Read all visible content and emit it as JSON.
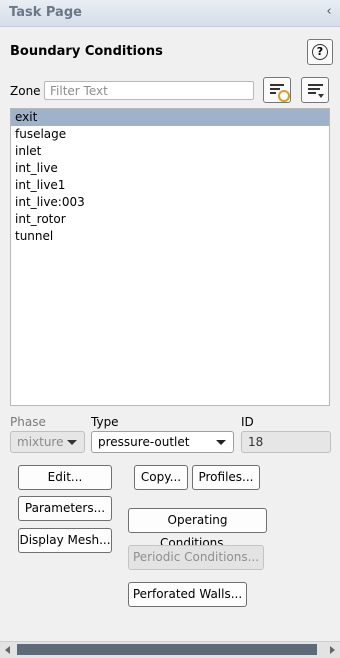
{
  "panel": {
    "title": "Task Page",
    "collapse_glyph": "‹"
  },
  "heading": "Boundary Conditions",
  "help_glyph": "?",
  "zone": {
    "label": "Zone",
    "filter_placeholder": "Filter Text",
    "filter_value": "",
    "items": [
      "exit",
      "fuselage",
      "inlet",
      "int_live",
      "int_live1",
      "int_live:003",
      "int_rotor",
      "tunnel"
    ],
    "selected_index": 0
  },
  "fields": {
    "phase_label": "Phase",
    "phase_value": "mixture",
    "type_label": "Type",
    "type_value": "pressure-outlet",
    "id_label": "ID",
    "id_value": "18"
  },
  "buttons": {
    "edit": "Edit...",
    "copy": "Copy...",
    "profiles": "Profiles...",
    "parameters": "Parameters...",
    "operating_conditions": "Operating Conditions...",
    "display_mesh": "Display Mesh...",
    "periodic_conditions": "Periodic Conditions...",
    "perforated_walls": "Perforated Walls..."
  },
  "colors": {
    "selection": "#9eb3c9",
    "scroll_thumb": "#5f6a78",
    "title_text": "#6a7786"
  }
}
